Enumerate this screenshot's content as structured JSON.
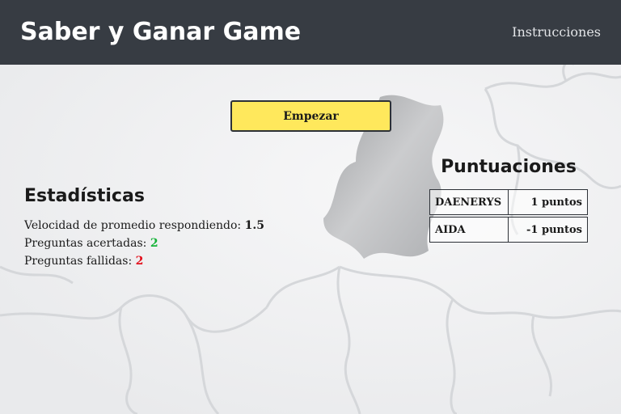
{
  "header": {
    "title": "Saber y Ganar Game",
    "nav_instructions": "Instrucciones"
  },
  "main": {
    "start_button_label": "Empezar"
  },
  "stats": {
    "title": "Estadísticas",
    "items": [
      {
        "label": "Velocidad de promedio respondiendo:",
        "value": "1.5"
      },
      {
        "label": "Preguntas acertadas:",
        "value": "2"
      },
      {
        "label": "Preguntas fallidas:",
        "value": "2"
      }
    ]
  },
  "scores": {
    "title": "Puntuaciones",
    "rows": [
      {
        "player": "DAENERYS",
        "points": "1 puntos"
      },
      {
        "player": "AIDA",
        "points": "-1 puntos"
      }
    ]
  },
  "colors": {
    "header_bg": "#373c43",
    "button_bg": "#ffe85c",
    "correct": "#17b33a",
    "wrong": "#e3101c"
  },
  "background_image": "jigsaw-puzzle-pieces-with-missing-piece"
}
